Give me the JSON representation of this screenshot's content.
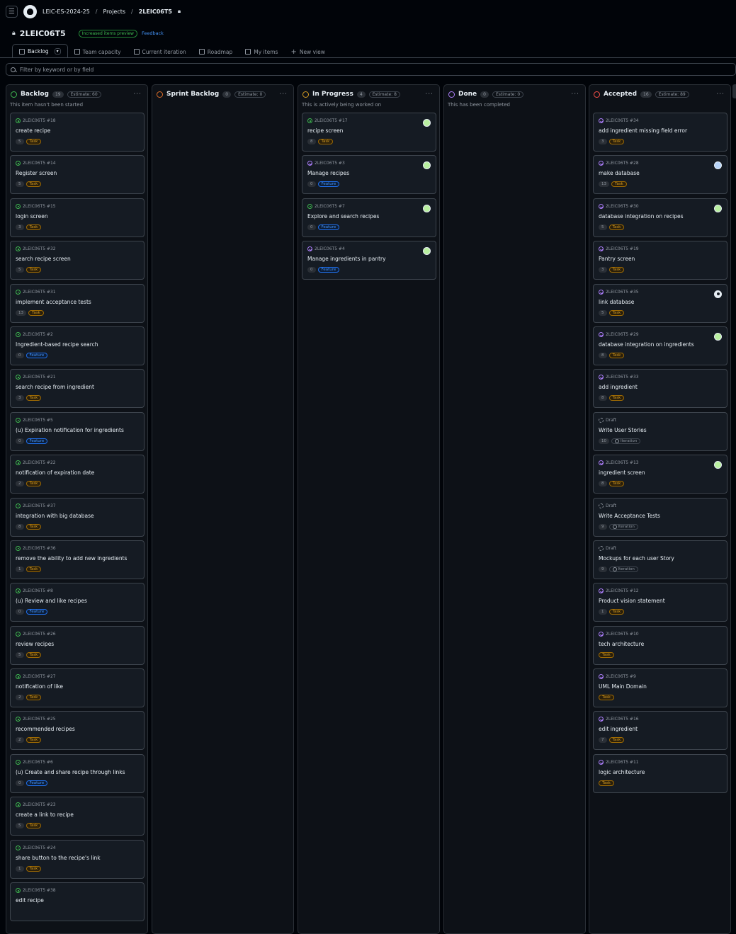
{
  "breadcrumb": {
    "org": "LEIC-ES-2024-25",
    "projects": "Projects",
    "project": "2LEIC06T5"
  },
  "header": {
    "title": "2LEIC06T5",
    "preview_badge": "Increased items preview",
    "feedback": "Feedback"
  },
  "views": [
    {
      "label": "Backlog",
      "icon": "board-icon",
      "active": true
    },
    {
      "label": "Team capacity",
      "icon": "table-icon"
    },
    {
      "label": "Current iteration",
      "icon": "board-icon"
    },
    {
      "label": "Roadmap",
      "icon": "roadmap-icon"
    },
    {
      "label": "My items",
      "icon": "table-icon"
    },
    {
      "label": "New view",
      "icon": "plus-icon"
    }
  ],
  "filter": {
    "placeholder": "Filter by keyword or by field"
  },
  "colors": {
    "accent": "#4493f8",
    "task": "#d29922",
    "feature": "#4493f8",
    "open": "#3fb950",
    "done": "#ab7df8"
  },
  "columns": [
    {
      "name": "Backlog",
      "count": "19",
      "estimate": "Estimate: 60",
      "description": "This item hasn't been started",
      "color": "#3fb950",
      "cards": [
        {
          "ref": "2LEIC06T5 #18",
          "title": "create recipe",
          "num": "5",
          "label": "Task",
          "state": "open"
        },
        {
          "ref": "2LEIC06T5 #14",
          "title": "Register screen",
          "num": "5",
          "label": "Task",
          "state": "open"
        },
        {
          "ref": "2LEIC06T5 #15",
          "title": "login screen",
          "num": "3",
          "label": "Task",
          "state": "open"
        },
        {
          "ref": "2LEIC06T5 #32",
          "title": "search recipe screen",
          "num": "5",
          "label": "Task",
          "state": "open"
        },
        {
          "ref": "2LEIC06T5 #31",
          "title": "implement acceptance tests",
          "num": "13",
          "label": "Task",
          "state": "open"
        },
        {
          "ref": "2LEIC06T5 #2",
          "title": "Ingredient-based recipe search",
          "num": "0",
          "label": "Feature",
          "state": "open"
        },
        {
          "ref": "2LEIC06T5 #21",
          "title": "search recipe from ingredient",
          "num": "3",
          "label": "Task",
          "state": "open"
        },
        {
          "ref": "2LEIC06T5 #5",
          "title": "(u) Expiration notification for ingredients",
          "num": "0",
          "label": "Feature",
          "state": "open"
        },
        {
          "ref": "2LEIC06T5 #22",
          "title": "notification of expiration date",
          "num": "2",
          "label": "Task",
          "state": "open"
        },
        {
          "ref": "2LEIC06T5 #37",
          "title": "integration with big database",
          "num": "8",
          "label": "Task",
          "state": "open"
        },
        {
          "ref": "2LEIC06T5 #36",
          "title": "remove the ability to add new ingredients",
          "num": "1",
          "label": "Task",
          "state": "open"
        },
        {
          "ref": "2LEIC06T5 #8",
          "title": "(u) Review and like recipes",
          "num": "0",
          "label": "Feature",
          "state": "open"
        },
        {
          "ref": "2LEIC06T5 #26",
          "title": "review recipes",
          "num": "5",
          "label": "Task",
          "state": "open"
        },
        {
          "ref": "2LEIC06T5 #27",
          "title": "notification of like",
          "num": "2",
          "label": "Task",
          "state": "open"
        },
        {
          "ref": "2LEIC06T5 #25",
          "title": "recommended recipes",
          "num": "2",
          "label": "Task",
          "state": "open"
        },
        {
          "ref": "2LEIC06T5 #6",
          "title": "(u) Create and share recipe through links",
          "num": "0",
          "label": "Feature",
          "state": "open"
        },
        {
          "ref": "2LEIC06T5 #23",
          "title": "create a link to recipe",
          "num": "5",
          "label": "Task",
          "state": "open"
        },
        {
          "ref": "2LEIC06T5 #24",
          "title": "share button to the recipe's link",
          "num": "1",
          "label": "Task",
          "state": "open"
        },
        {
          "ref": "2LEIC06T5 #38",
          "title": "edit recipe",
          "state": "open"
        }
      ]
    },
    {
      "name": "Sprint Backlog",
      "count": "0",
      "estimate": "Estimate: 0",
      "description": "",
      "color": "#db6d28",
      "cards": []
    },
    {
      "name": "In Progress",
      "count": "4",
      "estimate": "Estimate: 8",
      "description": "This is actively being worked on",
      "color": "#d29922",
      "cards": [
        {
          "ref": "2LEIC06T5 #17",
          "title": "recipe screen",
          "num": "8",
          "label": "Task",
          "state": "open",
          "avatar": "green"
        },
        {
          "ref": "2LEIC06T5 #3",
          "title": "Manage recipes",
          "num": "0",
          "label": "Feature",
          "state": "done",
          "avatar": "green"
        },
        {
          "ref": "2LEIC06T5 #7",
          "title": "Explore and search recipes",
          "num": "0",
          "label": "Feature",
          "state": "open",
          "avatar": "green"
        },
        {
          "ref": "2LEIC06T5 #4",
          "title": "Manage ingredients in pantry",
          "num": "0",
          "label": "Feature",
          "state": "done",
          "avatar": "green"
        }
      ]
    },
    {
      "name": "Done",
      "count": "0",
      "estimate": "Estimate: 0",
      "description": "This has been completed",
      "color": "#ab7df8",
      "cards": []
    },
    {
      "name": "Accepted",
      "count": "16",
      "estimate": "Estimate: 89",
      "description": "",
      "color": "#f85149",
      "cards": [
        {
          "ref": "2LEIC06T5 #34",
          "title": "add ingredient missing field error",
          "num": "3",
          "label": "Task",
          "state": "done"
        },
        {
          "ref": "2LEIC06T5 #28",
          "title": "make database",
          "num": "13",
          "label": "Task",
          "state": "done",
          "avatar": "blue"
        },
        {
          "ref": "2LEIC06T5 #30",
          "title": "database integration on recipes",
          "num": "5",
          "label": "Task",
          "state": "done",
          "avatar": "green"
        },
        {
          "ref": "2LEIC06T5 #19",
          "title": "Pantry screen",
          "num": "3",
          "label": "Task",
          "state": "done"
        },
        {
          "ref": "2LEIC06T5 #35",
          "title": "link database",
          "num": "5",
          "label": "Task",
          "state": "done",
          "avatar": "face"
        },
        {
          "ref": "2LEIC06T5 #29",
          "title": "database integration on ingredients",
          "num": "8",
          "label": "Task",
          "state": "done",
          "avatar": "green"
        },
        {
          "ref": "2LEIC06T5 #33",
          "title": "add ingredient",
          "num": "8",
          "label": "Task",
          "state": "done"
        },
        {
          "ref": "Draft",
          "title": "Write User Stories",
          "num": "10",
          "label": "Iteration",
          "state": "draft"
        },
        {
          "ref": "2LEIC06T5 #13",
          "title": "ingredient screen",
          "num": "8",
          "label": "Task",
          "state": "done",
          "avatar": "green"
        },
        {
          "ref": "Draft",
          "title": "Write Acceptance Tests",
          "num": "9",
          "label": "Iteration",
          "state": "draft"
        },
        {
          "ref": "Draft",
          "title": "Mockups for each user Story",
          "num": "9",
          "label": "Iteration",
          "state": "draft"
        },
        {
          "ref": "2LEIC06T5 #12",
          "title": "Product vision statement",
          "num": "1",
          "label": "Task",
          "state": "done"
        },
        {
          "ref": "2LEIC06T5 #10",
          "title": "tech architecture",
          "label": "Task",
          "state": "done"
        },
        {
          "ref": "2LEIC06T5 #9",
          "title": "UML Main Domain",
          "label": "Task",
          "state": "done"
        },
        {
          "ref": "2LEIC06T5 #16",
          "title": "edit ingredient",
          "num": "7",
          "label": "Task",
          "state": "done"
        },
        {
          "ref": "2LEIC06T5 #11",
          "title": "logic architecture",
          "label": "Task",
          "state": "done"
        }
      ]
    }
  ]
}
